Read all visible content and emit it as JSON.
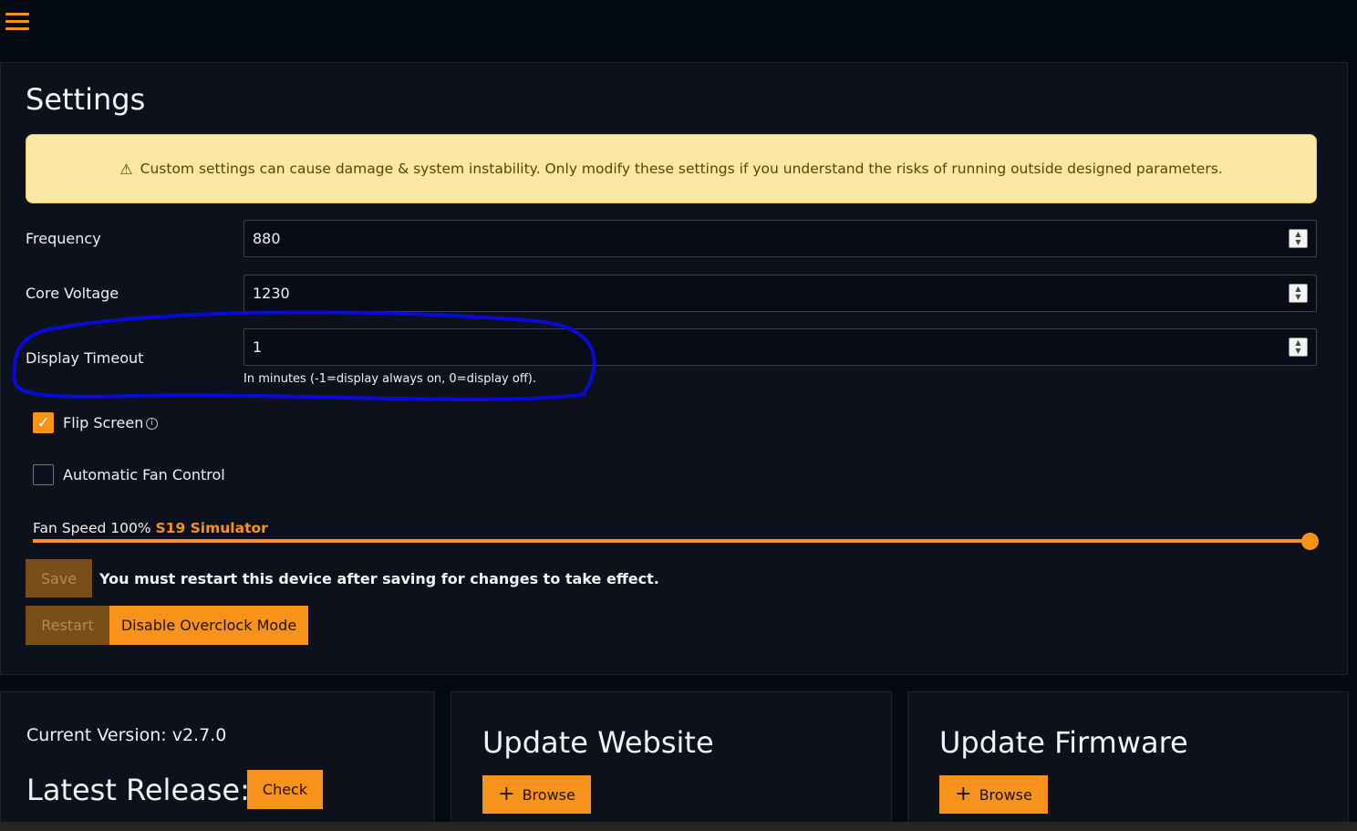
{
  "header": {
    "menu_icon": "hamburger-menu-icon"
  },
  "settings": {
    "title": "Settings",
    "warning": {
      "icon": "warning-triangle-icon",
      "icon_glyph": "⚠",
      "text": "Custom settings can cause damage & system instability. Only modify these settings if you understand the risks of running outside designed parameters."
    },
    "frequency": {
      "label": "Frequency",
      "value": "880"
    },
    "core_voltage": {
      "label": "Core Voltage",
      "value": "1230"
    },
    "display_timeout": {
      "label": "Display Timeout",
      "value": "1",
      "hint": "In minutes (-1=display always on, 0=display off)."
    },
    "flip_screen": {
      "label": "Flip Screen",
      "checked": true,
      "check_glyph": "✓",
      "info_icon": "info-circle-icon",
      "info_glyph": "i"
    },
    "auto_fan": {
      "label": "Automatic Fan Control",
      "checked": false
    },
    "fan_speed": {
      "label": "Fan Speed 100%",
      "device": "S19 Simulator",
      "percent": 100
    },
    "save_label": "Save",
    "restart_note": "You must restart this device after saving for changes to take effect.",
    "restart_label": "Restart",
    "overclock_label": "Disable Overclock Mode",
    "spinner_up": "▲",
    "spinner_down": "▼"
  },
  "version_card": {
    "current_version": "Current Version: v2.7.0",
    "latest_release": "Latest Release:",
    "check_label": "Check"
  },
  "update_website": {
    "title": "Update Website",
    "browse_label": "Browse",
    "plus": "+"
  },
  "update_firmware": {
    "title": "Update Firmware",
    "browse_label": "Browse",
    "plus": "+"
  },
  "colors": {
    "accent": "#f7931a",
    "background": "#040a14",
    "card": "#0c111c",
    "warning_bg": "#fde7a6"
  }
}
